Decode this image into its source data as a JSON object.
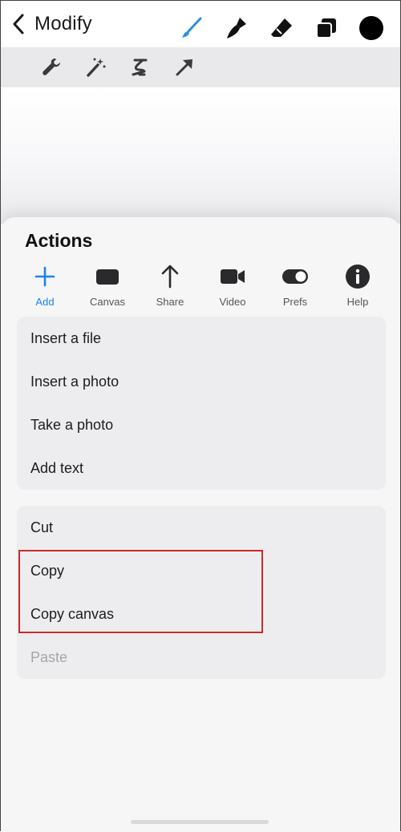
{
  "topbar": {
    "back_label": "Modify",
    "tools": [
      {
        "icon": "brush-icon",
        "color": "#2c8fe0"
      },
      {
        "icon": "smudge-icon",
        "color": "#111111"
      },
      {
        "icon": "eraser-icon",
        "color": "#111111"
      },
      {
        "icon": "layers-icon",
        "color": "#111111"
      },
      {
        "icon": "color-icon",
        "color": "#000000"
      }
    ]
  },
  "subbar": {
    "tools": [
      {
        "icon": "wrench-icon"
      },
      {
        "icon": "magic-wand-icon"
      },
      {
        "icon": "selection-icon"
      },
      {
        "icon": "transform-arrow-icon"
      }
    ]
  },
  "sheet": {
    "title": "Actions",
    "tabs": [
      {
        "label": "Add",
        "icon": "plus-icon",
        "active": true
      },
      {
        "label": "Canvas",
        "icon": "canvas-icon",
        "active": false
      },
      {
        "label": "Share",
        "icon": "share-icon",
        "active": false
      },
      {
        "label": "Video",
        "icon": "video-icon",
        "active": false
      },
      {
        "label": "Prefs",
        "icon": "toggle-icon",
        "active": false
      },
      {
        "label": "Help",
        "icon": "info-icon",
        "active": false
      }
    ],
    "group1": [
      "Insert a file",
      "Insert a photo",
      "Take a photo",
      "Add text"
    ],
    "group2": [
      "Cut",
      "Copy",
      "Copy canvas",
      "Paste"
    ]
  },
  "colors": {
    "accent": "#1e82e8",
    "highlight": "#cc2a2a"
  }
}
